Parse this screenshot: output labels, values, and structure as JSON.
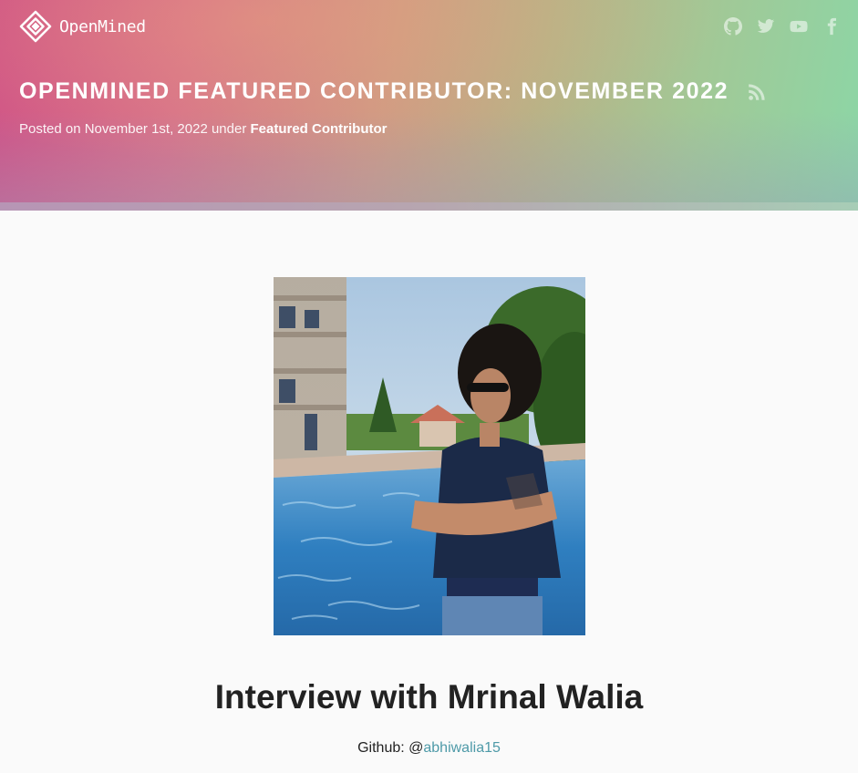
{
  "site": {
    "brand_name": "OpenMined",
    "logo_icon": "openmined-diamond-logo",
    "social_icons": [
      "github-icon",
      "twitter-icon",
      "youtube-icon",
      "facebook-icon"
    ]
  },
  "post": {
    "title": "OPENMINED FEATURED CONTRIBUTOR: NOVEMBER 2022",
    "meta_prefix": "Posted on November 1st, 2022 under ",
    "category": "Featured Contributor",
    "rss_icon": "rss-icon"
  },
  "article": {
    "heading": "Interview with Mrinal Walia",
    "github_label": "Github: @",
    "github_handle": "abhiwalia15"
  },
  "colors": {
    "hero_left": "#cf5187",
    "hero_mid": "#cf9a84",
    "hero_right": "#8cd6a6",
    "link": "#4e9aa8",
    "text": "#222222",
    "background": "#fafafa"
  }
}
